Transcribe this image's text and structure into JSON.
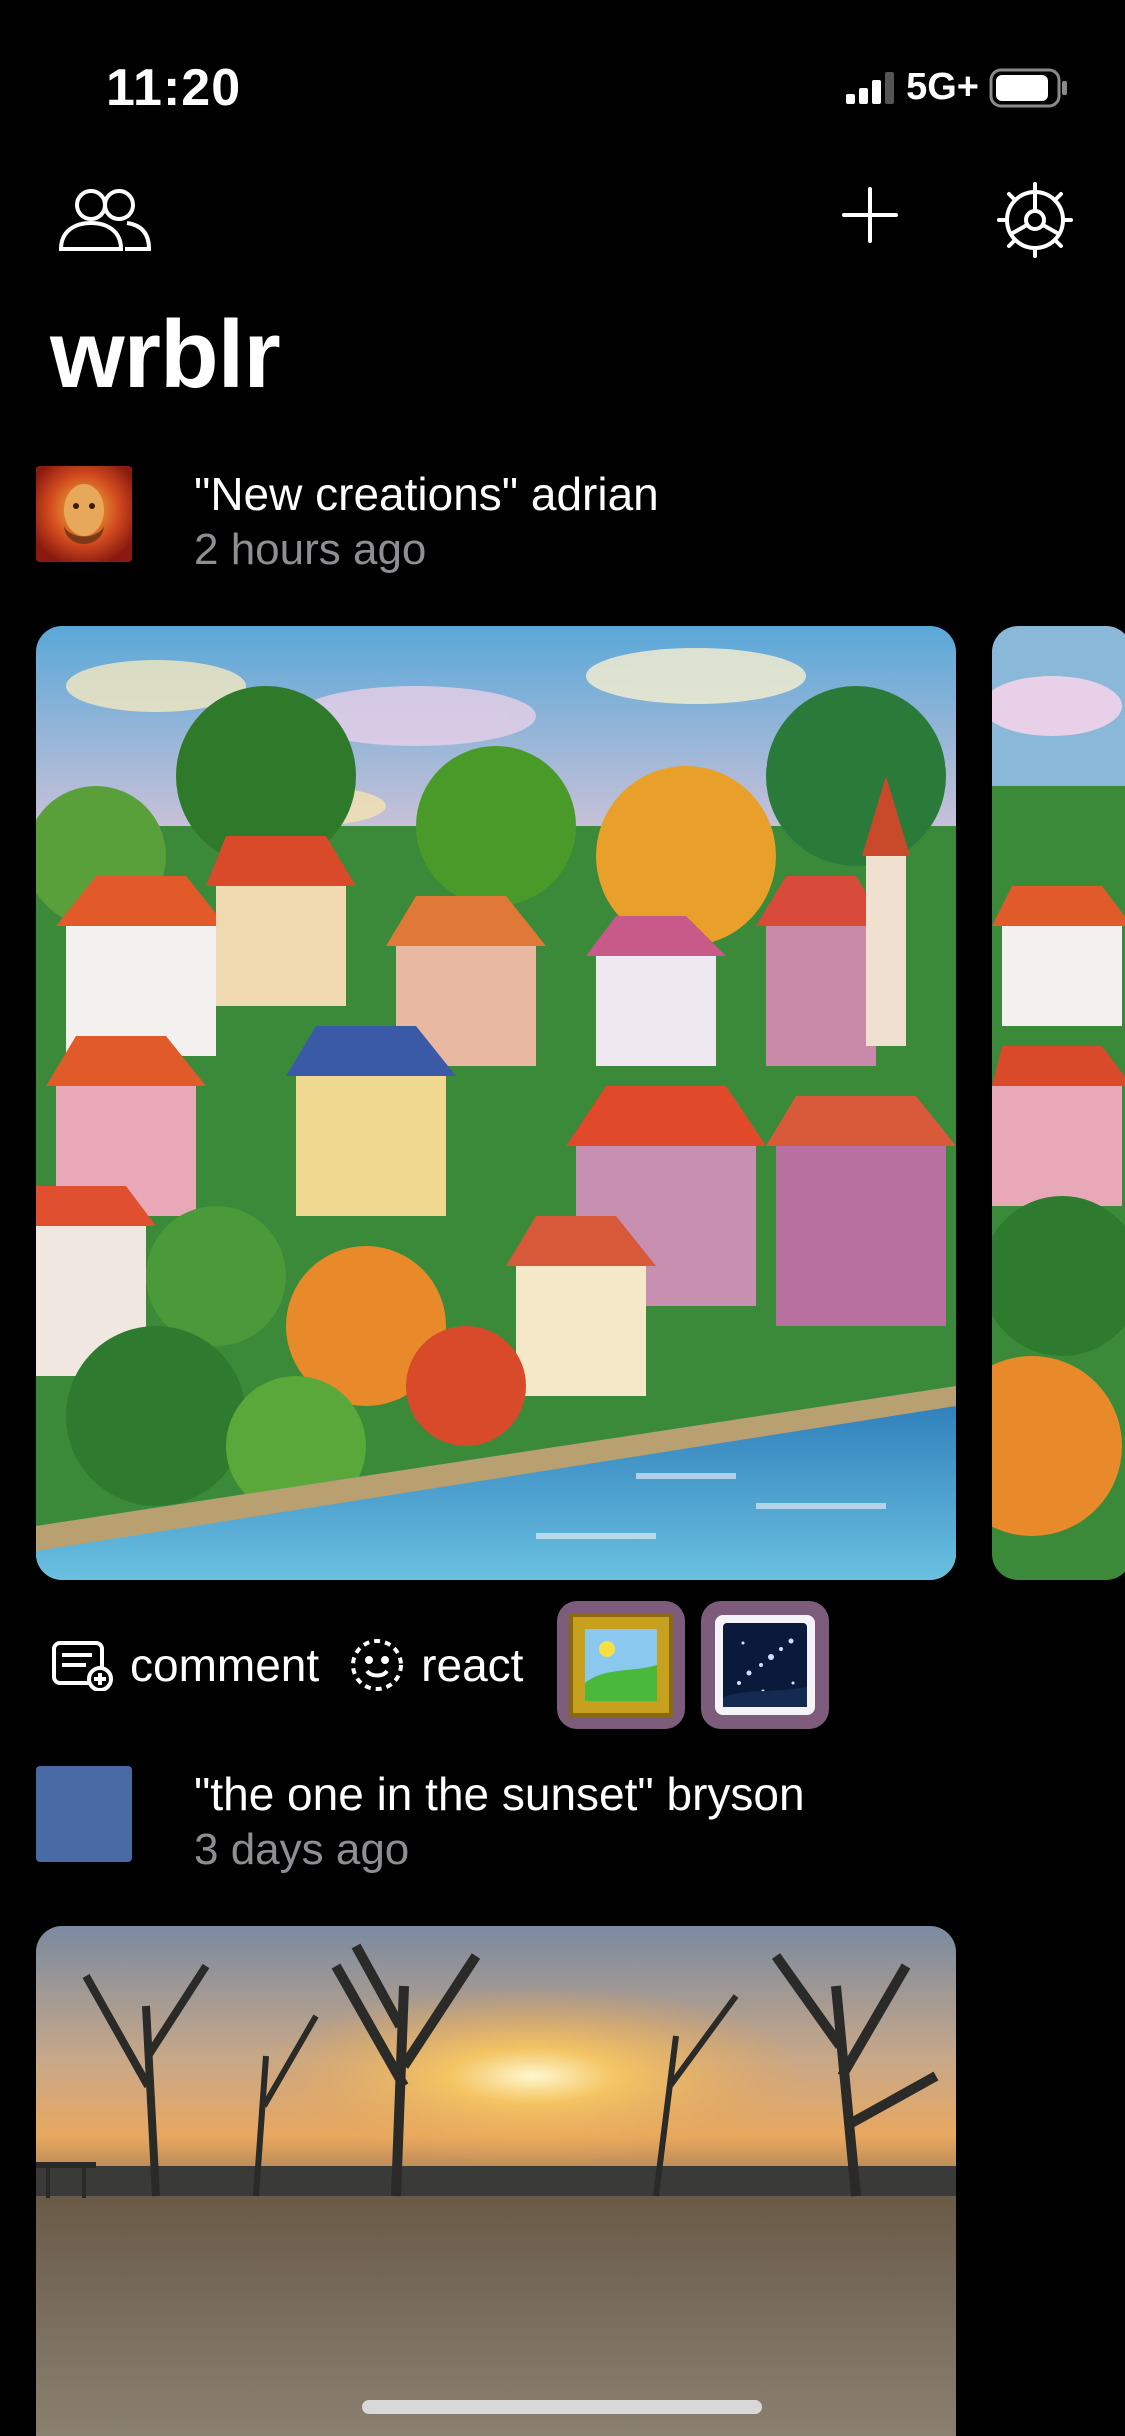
{
  "status_bar": {
    "time": "11:20",
    "network": "5G+",
    "signal_bars": 3,
    "battery_level": 0.85
  },
  "header": {
    "title": "wrblr",
    "icons": [
      "friends-icon",
      "plus-icon",
      "settings-icon"
    ]
  },
  "posts": [
    {
      "title": "\"New creations\" adrian",
      "time": "2 hours ago",
      "avatar_icon": "portrait-avatar",
      "images": [
        "painted-village-artwork",
        "painted-village-artwork-2"
      ],
      "actions": {
        "comment_label": "comment",
        "react_label": "react"
      },
      "reactions": [
        "framed-landscape-icon",
        "night-sky-icon"
      ]
    },
    {
      "title": "\"the one in the sunset\" bryson",
      "time": "3 days ago",
      "avatar_color": "#4a6aa6",
      "images": [
        "sunset-photo"
      ]
    }
  ],
  "colors": {
    "background": "#000000",
    "secondary_text": "#8e8e93",
    "reaction_bg": "#7c5b7b"
  }
}
